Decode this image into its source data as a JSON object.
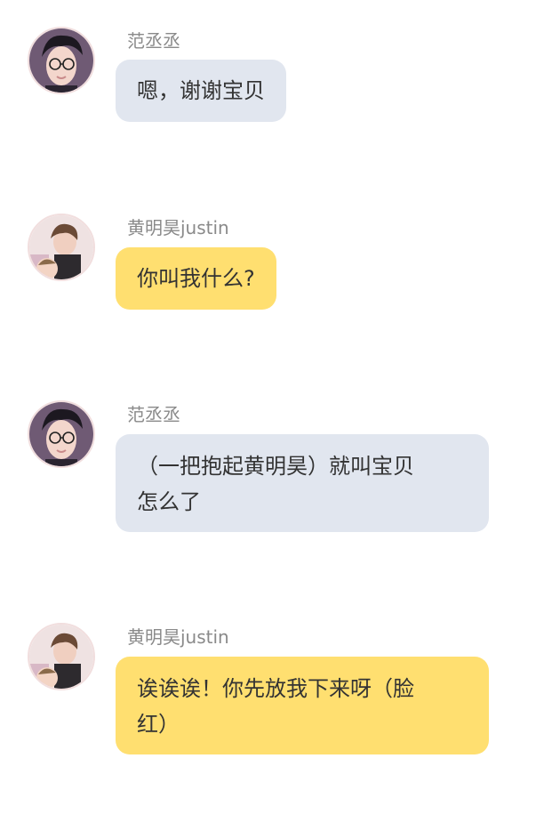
{
  "messages": [
    {
      "sender": "范丞丞",
      "lines": [
        "嗯，谢谢宝贝"
      ],
      "color": "#e1e6ef",
      "avatar": "avatar-fan-chengcheng"
    },
    {
      "sender": "黄明昊justin",
      "lines": [
        "你叫我什么?"
      ],
      "color": "#ffdf70",
      "avatar": "avatar-huang-minghao"
    },
    {
      "sender": "范丞丞",
      "lines": [
        "（一把抱起黄明昊）就叫宝贝",
        "怎么了"
      ],
      "color": "#e1e6ef",
      "avatar": "avatar-fan-chengcheng"
    },
    {
      "sender": "黄明昊justin",
      "lines": [
        "诶诶诶！你先放我下来呀（脸",
        "红）"
      ],
      "color": "#ffdf70",
      "avatar": "avatar-huang-minghao"
    }
  ]
}
